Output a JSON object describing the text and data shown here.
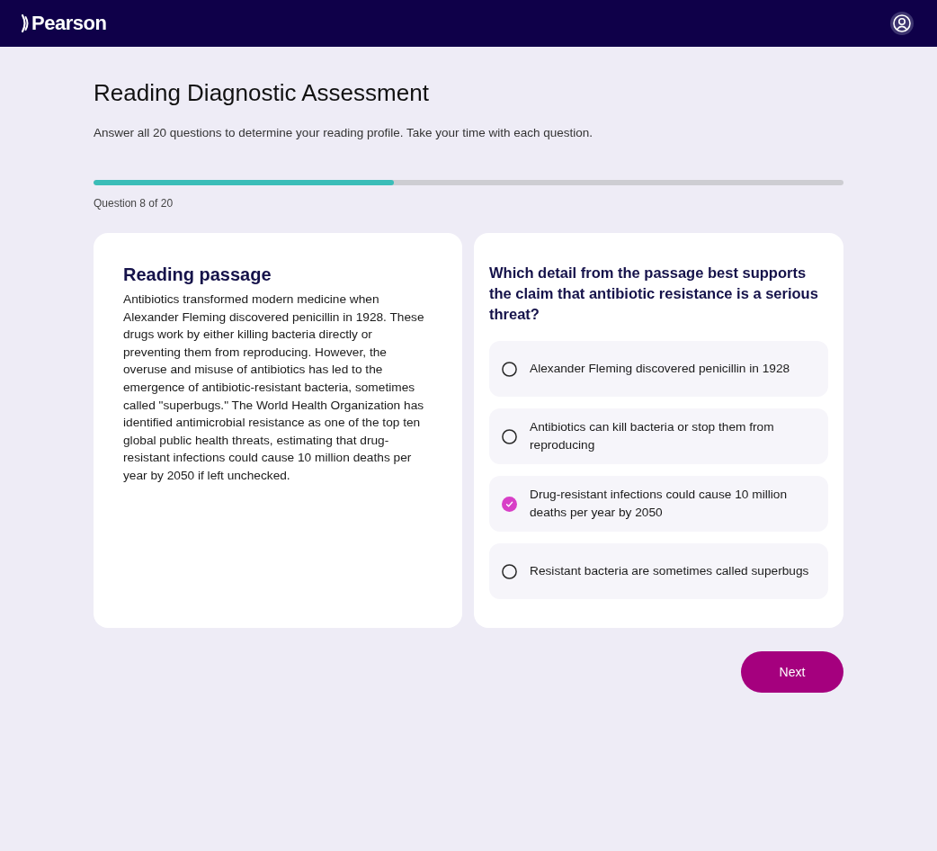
{
  "header": {
    "logo": "Pearson"
  },
  "assessment": {
    "title": "Reading Diagnostic Assessment",
    "subtitle": "Answer all 20 questions to determine your reading profile. Take your time with each question.",
    "progress": {
      "level": 0.4,
      "label": "Question 8 of 20"
    }
  },
  "passage": {
    "heading": "Reading passage",
    "text": "Antibiotics transformed modern medicine when Alexander Fleming discovered penicillin in 1928. These drugs work by either killing bacteria directly or preventing them from reproducing. However, the overuse and misuse of antibiotics has led to the emergence of antibiotic-resistant bacteria, sometimes called \"superbugs.\" The World Health Organization has identified antimicrobial resistance as one of the top ten global public health threats, estimating that drug-resistant infections could cause 10 million deaths per year by 2050 if left unchecked."
  },
  "question": {
    "prompt": "Which detail from the passage best supports the claim that antibiotic resistance is a serious threat?",
    "options": [
      {
        "label": "Alexander Fleming discovered penicillin in 1928",
        "selected": false
      },
      {
        "label": "Antibiotics can kill bacteria or stop them from reproducing",
        "selected": false
      },
      {
        "label": "Drug-resistant infections could cause 10 million deaths per year by 2050",
        "selected": true
      },
      {
        "label": "Resistant bacteria are sometimes called superbugs",
        "selected": false
      }
    ]
  },
  "actions": {
    "next": "Next"
  }
}
